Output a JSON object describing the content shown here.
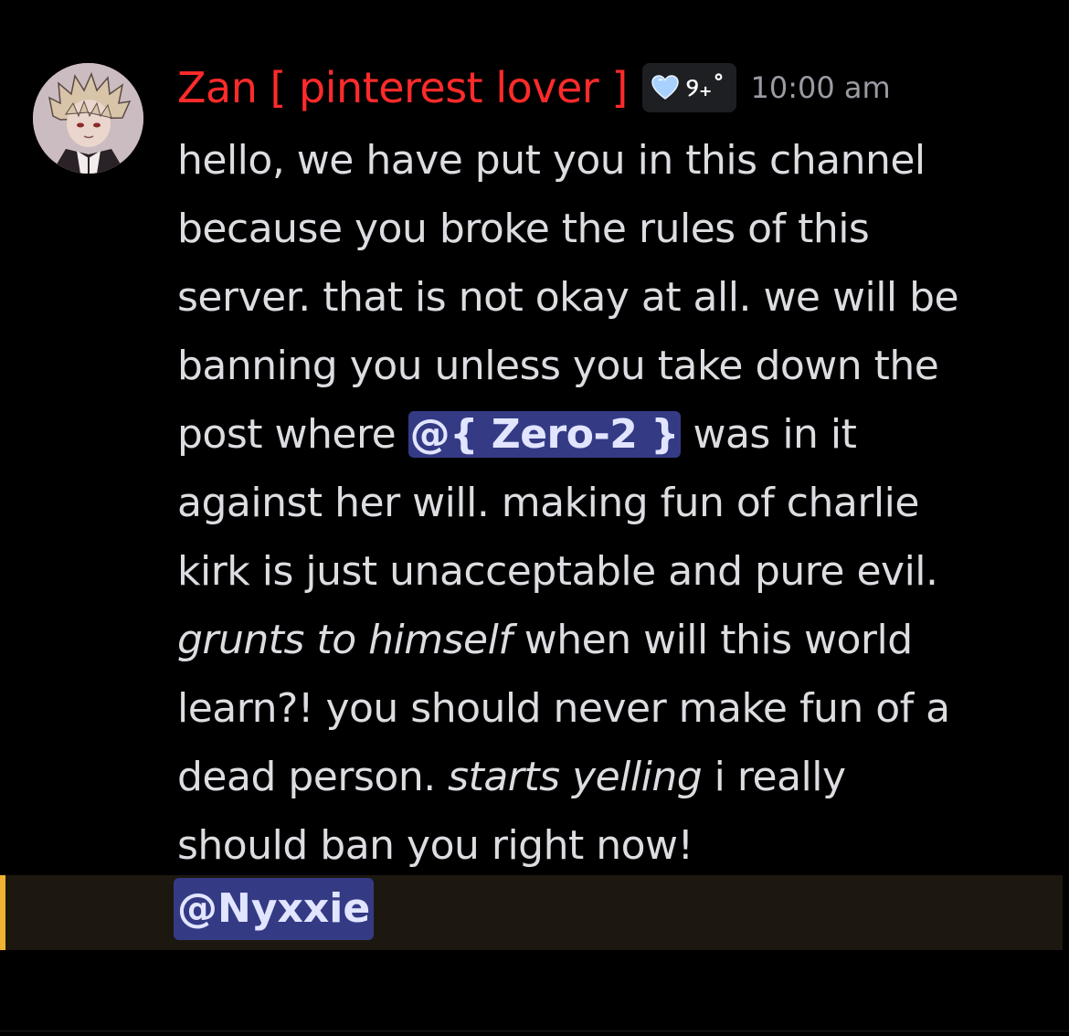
{
  "message": {
    "username": "Zan [ pinterest lover ]",
    "tag": {
      "icon": "heart-icon",
      "text": "୨₊˚"
    },
    "timestamp": "10:00 am",
    "avatar": "avatar",
    "lines": {
      "l1": "hello, we have put you in this channel",
      "l2": "because you broke the rules of this",
      "l3": "server. that is not okay at all. we will be",
      "l4": "banning you unless you take down the",
      "l5_before": "post where ",
      "l5_mention": "@{ Zero-2 }",
      "l5_after": " was in it",
      "l6": "against her will. making fun of charlie",
      "l7": "kirk is just unacceptable and pure evil.",
      "l8_italic": "grunts to himself",
      "l8_after": " when will this world",
      "l9": "learn?! you should never make fun of a",
      "l10_before": "dead person. ",
      "l10_italic": "starts yelling",
      "l10_after": " i really",
      "l11": "should ban you right now!"
    },
    "reply_mention": "@Nyxxie"
  },
  "colors": {
    "background": "#000000",
    "username": "#ff2b2b",
    "mention_bg": "#343b84",
    "mention_text": "#e2e5ff",
    "highlight_bg": "#1c1810",
    "highlight_bar": "#f0b232",
    "timestamp": "#9a9ba3",
    "tag_bg": "#1e1f22"
  }
}
